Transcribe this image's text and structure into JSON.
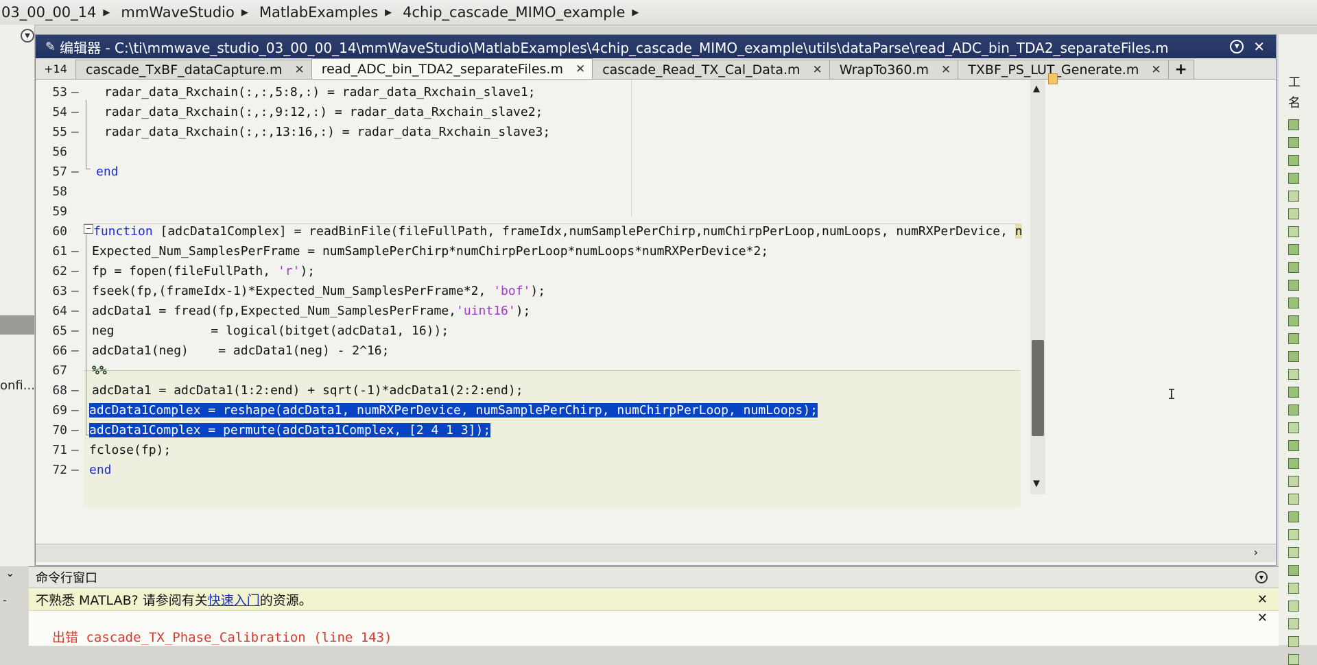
{
  "breadcrumb": [
    "03_00_00_14",
    "mmWaveStudio",
    "MatlabExamples",
    "4chip_cascade_MIMO_example"
  ],
  "left_pane": {
    "label_fragment": "onfi..."
  },
  "editor": {
    "title": "编辑器 - C:\\ti\\mmwave_studio_03_00_00_14\\mmWaveStudio\\MatlabExamples\\4chip_cascade_MIMO_example\\utils\\dataParse\\read_ADC_bin_TDA2_separateFiles.m",
    "tab_overflow": "+14",
    "tabs": [
      {
        "label": "cascade_TxBF_dataCapture.m",
        "active": false
      },
      {
        "label": "read_ADC_bin_TDA2_separateFiles.m",
        "active": true
      },
      {
        "label": "cascade_Read_TX_Cal_Data.m",
        "active": false
      },
      {
        "label": "WrapTo360.m",
        "active": false
      },
      {
        "label": "TXBF_PS_LUT_Generate.m",
        "active": false
      }
    ],
    "add_tab": "+",
    "lines": [
      {
        "num": "53",
        "mark": "—",
        "text": "radar_data_Rxchain(:,:,5:8,:) = radar_data_Rxchain_slave1;"
      },
      {
        "num": "54",
        "mark": "—",
        "text": "radar_data_Rxchain(:,:,9:12,:) = radar_data_Rxchain_slave2;"
      },
      {
        "num": "55",
        "mark": "—",
        "text": "radar_data_Rxchain(:,:,13:16,:) = radar_data_Rxchain_slave3;"
      },
      {
        "num": "56",
        "mark": "",
        "text": ""
      },
      {
        "num": "57",
        "mark": "—",
        "text": "end"
      },
      {
        "num": "58",
        "mark": "",
        "text": ""
      },
      {
        "num": "59",
        "mark": "",
        "text": ""
      },
      {
        "num": "60",
        "mark": "",
        "kw": "function",
        "text": " [adcData1Complex] = readBinFile(fileFullPath, frameIdx,numSamplePerChirp,numChirpPerLoop,numLoops, numRXPerDevice, ",
        "hl": "numDevices",
        "tail": ")"
      },
      {
        "num": "61",
        "mark": "—",
        "text": "Expected_Num_SamplesPerFrame = numSamplePerChirp*numChirpPerLoop*numLoops*numRXPerDevice*2;"
      },
      {
        "num": "62",
        "mark": "—",
        "pre": "fp = fopen(fileFullPath, ",
        "str": "'r'",
        "post": ");"
      },
      {
        "num": "63",
        "mark": "—",
        "pre": "fseek(fp,(frameIdx-1)*Expected_Num_SamplesPerFrame*2, ",
        "str": "'bof'",
        "post": ");"
      },
      {
        "num": "64",
        "mark": "—",
        "pre": "adcData1 = fread(fp,Expected_Num_SamplesPerFrame,",
        "str": "'uint16'",
        "post": ");"
      },
      {
        "num": "65",
        "mark": "—",
        "text": "neg             = logical(bitget(adcData1, 16));"
      },
      {
        "num": "66",
        "mark": "—",
        "text": "adcData1(neg)    = adcData1(neg) - 2^16;"
      },
      {
        "num": "67",
        "mark": "",
        "cell": "%%"
      },
      {
        "num": "68",
        "mark": "—",
        "text": "adcData1 = adcData1(1:2:end) + sqrt(-1)*adcData1(2:2:end);"
      },
      {
        "num": "69",
        "mark": "—",
        "sel": "adcData1Complex = reshape(adcData1, numRXPerDevice, numSamplePerChirp, numChirpPerLoop, numLoops);"
      },
      {
        "num": "70",
        "mark": "—",
        "sel": "adcData1Complex = permute(adcData1Complex, [2 4 1 3]);"
      },
      {
        "num": "71",
        "mark": "—",
        "text": "fclose(fp);"
      },
      {
        "num": "72",
        "mark": "—",
        "text": "end"
      }
    ]
  },
  "command_window": {
    "title": "命令行窗口",
    "notice_prefix": "不熟悉 MATLAB? 请参阅有关",
    "notice_link": "快速入门",
    "notice_suffix": "的资源。",
    "error_text": "出错 cascade_TX_Phase_Calibration (line 143)"
  },
  "right_toolbar": {
    "top_glyphs": [
      "工",
      "名"
    ]
  }
}
